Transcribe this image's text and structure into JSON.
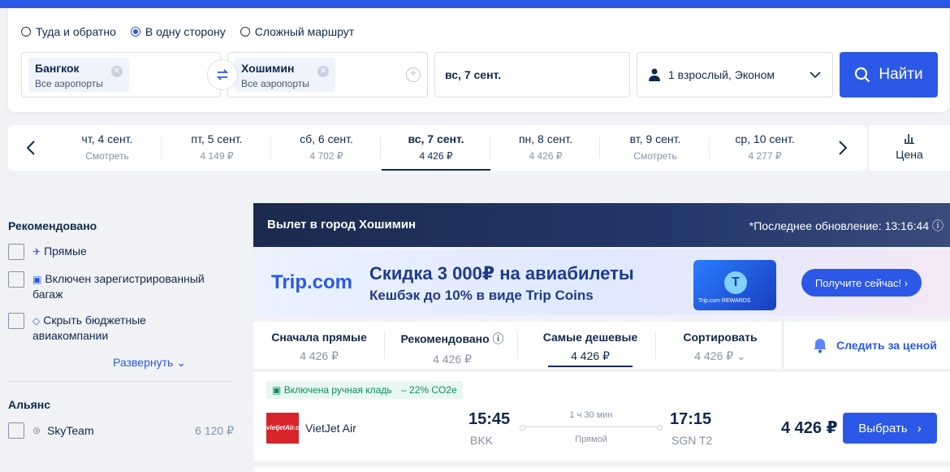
{
  "trip_types": [
    {
      "label": "Туда и обратно",
      "checked": false
    },
    {
      "label": "В одну сторону",
      "checked": true
    },
    {
      "label": "Сложный маршрут",
      "checked": false
    }
  ],
  "from": {
    "city": "Бангкок",
    "sub": "Все аэропорты"
  },
  "to": {
    "city": "Хошимин",
    "sub": "Все аэропорты"
  },
  "date": "вс, 7 сент.",
  "passengers": "1 взрослый, Эконом",
  "search_label": "Найти",
  "date_strip": [
    {
      "day": "чт, 4 сент.",
      "price": "Смотреть"
    },
    {
      "day": "пт, 5 сент.",
      "price": "4 149 ₽"
    },
    {
      "day": "сб, 6 сент.",
      "price": "4 702 ₽"
    },
    {
      "day": "вс, 7 сент.",
      "price": "4 426 ₽",
      "active": true
    },
    {
      "day": "пн, 8 сент.",
      "price": "4 426 ₽"
    },
    {
      "day": "вт, 9 сент.",
      "price": "Смотреть"
    },
    {
      "day": "ср, 10 сент.",
      "price": "4 277 ₽"
    }
  ],
  "price_tab": "Цена",
  "sidebar": {
    "recommended_title": "Рекомендовано",
    "filters": [
      "Прямые",
      "Включен зарегистрированный багаж",
      "Скрыть бюджетные авиакомпании"
    ],
    "expand": "Развернуть",
    "alliance_title": "Альянс",
    "alliances": [
      {
        "name": "SkyTeam",
        "price": "6 120 ₽"
      }
    ]
  },
  "banner": {
    "title": "Вылет в город Хошимин",
    "updated": "*Последнее обновление: 13:16:44"
  },
  "promo": {
    "logo": "Trip.com",
    "headline": "Скидка 3 000₽ на авиабилеты",
    "sub": "Кешбэк до 10% в виде Trip Coins",
    "card_label": "Trip.com REWARDS",
    "cta": "Получите сейчас!"
  },
  "sort": [
    {
      "label": "Сначала прямые",
      "value": "4 426 ₽"
    },
    {
      "label": "Рекомендовано",
      "value": "4 426 ₽",
      "info": true
    },
    {
      "label": "Самые дешевые",
      "value": "4 426 ₽",
      "active": true
    },
    {
      "label": "Сортировать",
      "value": "4 426 ₽",
      "dropdown": true
    }
  ],
  "watch_label": "Следить за ценой",
  "flight": {
    "tags": [
      "Включена ручная кладь",
      "– 22% CO2e"
    ],
    "airline": "VietJet Air",
    "logo_text": "vietjetAir.com",
    "dep_time": "15:45",
    "dep_code": "BKK",
    "duration": "1 ч 30 мин",
    "stops": "Прямой",
    "arr_time": "17:15",
    "arr_code": "SGN T2",
    "price": "4 426 ₽",
    "select": "Выбрать"
  },
  "colors": {
    "accent": "#2b58e6",
    "text": "#0f294d",
    "muted": "#8592a6"
  }
}
